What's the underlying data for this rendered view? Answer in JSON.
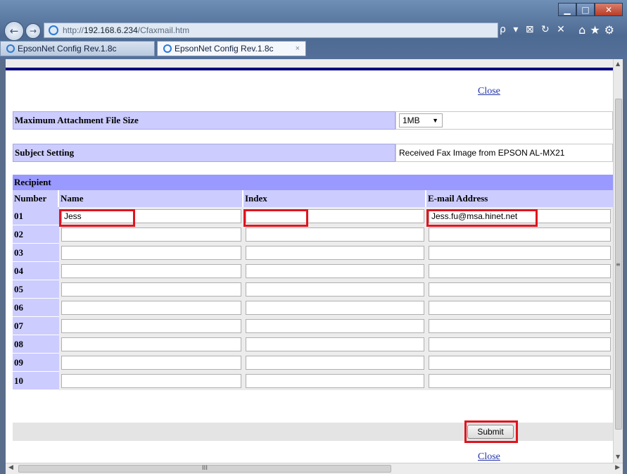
{
  "browser": {
    "url_prefix": "http://",
    "url_host": "192.168.6.234",
    "url_path": "/Cfaxmail.htm",
    "tabs": [
      {
        "label": "EpsonNet Config Rev.1.8c"
      },
      {
        "label": "EpsonNet Config Rev.1.8c"
      }
    ],
    "tab_close": "×",
    "addr_tools": "ρ ▾ ⊠ ↻ ✕",
    "right_icons": "⌂★⚙",
    "minimize": "▁",
    "maximize": "□",
    "close": "✕",
    "back": "←",
    "forward": "→"
  },
  "page": {
    "close_link_top": "Close",
    "close_link_bottom": "Close",
    "max_attachment_label": "Maximum Attachment File Size",
    "max_attachment_value": "1MB",
    "subject_label": "Subject Setting",
    "subject_value": "Received Fax Image from EPSON AL-MX21",
    "recipient_title": "Recipient",
    "columns": {
      "number": "Number",
      "name": "Name",
      "index": "Index",
      "email": "E-mail Address"
    },
    "rows": [
      {
        "number": "01",
        "name": "Jess",
        "index": "",
        "email": "Jess.fu@msa.hinet.net"
      },
      {
        "number": "02",
        "name": "",
        "index": "",
        "email": ""
      },
      {
        "number": "03",
        "name": "",
        "index": "",
        "email": ""
      },
      {
        "number": "04",
        "name": "",
        "index": "",
        "email": ""
      },
      {
        "number": "05",
        "name": "",
        "index": "",
        "email": ""
      },
      {
        "number": "06",
        "name": "",
        "index": "",
        "email": ""
      },
      {
        "number": "07",
        "name": "",
        "index": "",
        "email": ""
      },
      {
        "number": "08",
        "name": "",
        "index": "",
        "email": ""
      },
      {
        "number": "09",
        "name": "",
        "index": "",
        "email": ""
      },
      {
        "number": "10",
        "name": "",
        "index": "",
        "email": ""
      }
    ],
    "submit_label": "Submit"
  },
  "scroll": {
    "h_grip": "III",
    "up": "▲",
    "down": "▼",
    "left": "◀",
    "right": "▶",
    "v_grip": "≡"
  },
  "colors": {
    "highlight": "#e0141e",
    "header_blue": "#ccccff",
    "recipient_blue": "#9999ff",
    "rule": "#000080"
  }
}
